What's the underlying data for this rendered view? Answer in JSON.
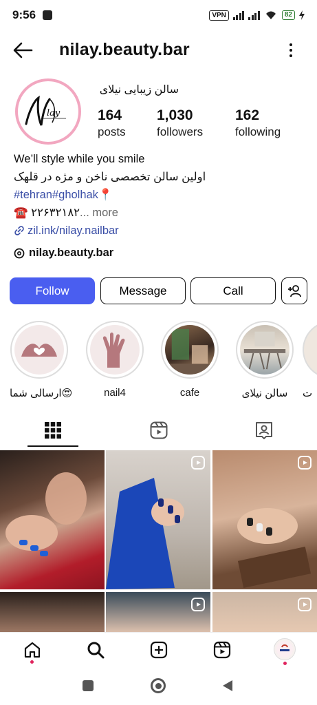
{
  "status_bar": {
    "time": "9:56",
    "vpn_label": "VPN",
    "battery": "82"
  },
  "header": {
    "username": "nilay.beauty.bar",
    "back_icon": "arrow-left-icon",
    "menu_icon": "more-vertical-icon"
  },
  "profile": {
    "display_name": "سالن زیبایی نیلای",
    "avatar_text": "Nilay",
    "stats": [
      {
        "value": "164",
        "label": "posts"
      },
      {
        "value": "1,030",
        "label": "followers"
      },
      {
        "value": "162",
        "label": "following"
      }
    ],
    "bio": {
      "line1": "We’ll style while you smile",
      "line2": "اولین سالن تخصصی ناخن و مژه در قلهک",
      "hashtags": "#tehran#gholhak",
      "pin": "📍",
      "phone_icon": "☎️",
      "phone": "۲۲۶۳۲۱۸۲",
      "more": "... more",
      "link": "zil.ink/nilay.nailbar"
    },
    "threads_handle": "nilay.beauty.bar"
  },
  "actions": {
    "follow": "Follow",
    "message": "Message",
    "call": "Call",
    "add_user_icon": "add-user-icon"
  },
  "highlights": [
    {
      "label": "ارسالی شما😍",
      "icon": "heart-hands-icon"
    },
    {
      "label": "nail4",
      "icon": "hand-icon"
    },
    {
      "label": "cafe",
      "icon": "cafe-photo"
    },
    {
      "label": "سالن نیلای",
      "icon": "salon-photo"
    },
    {
      "label": "ت",
      "icon": "partial-highlight"
    }
  ],
  "tabs": [
    {
      "name": "grid",
      "icon": "grid-icon",
      "active": true
    },
    {
      "name": "reels",
      "icon": "reels-icon",
      "active": false
    },
    {
      "name": "tagged",
      "icon": "tagged-icon",
      "active": false
    }
  ],
  "colors": {
    "accent": "#4a5ef0",
    "link": "#3b4fa7",
    "avatar_ring": "#f2a7c0",
    "highlight_rose": "#c98f94"
  },
  "bottom_nav": [
    {
      "icon": "home-icon"
    },
    {
      "icon": "search-icon"
    },
    {
      "icon": "create-icon"
    },
    {
      "icon": "reels-icon"
    },
    {
      "icon": "profile-avatar-icon"
    }
  ]
}
